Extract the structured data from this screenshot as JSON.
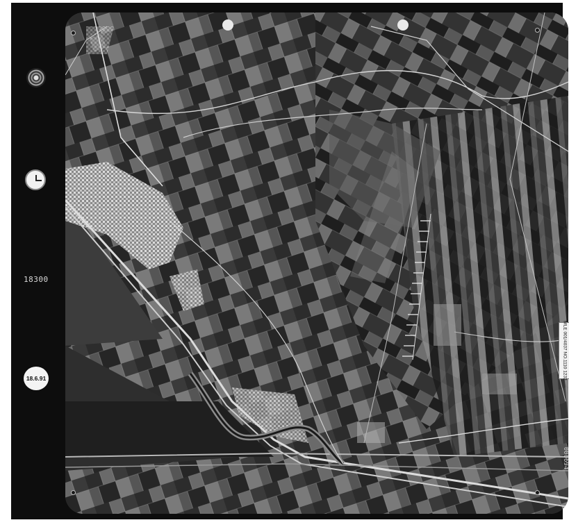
{
  "image": {
    "kind": "aerial-photograph",
    "tone": "black-and-white",
    "scene": "agricultural-plain-with-town-canal-and-river"
  },
  "margin_annotations": {
    "focal_length_text": "18300",
    "date_badge_small": "",
    "date_badge_text": "18.6.91",
    "side_label_text": "MLE 001/4037 NO.1110 1232",
    "frame_number": "000694"
  },
  "icons": {
    "level": "level-bubble-icon",
    "clock": "clock-icon"
  },
  "colors": {
    "film_border": "#0d0d0d",
    "page_background": "#ffffff",
    "annotation_text": "#d8d8d8"
  }
}
